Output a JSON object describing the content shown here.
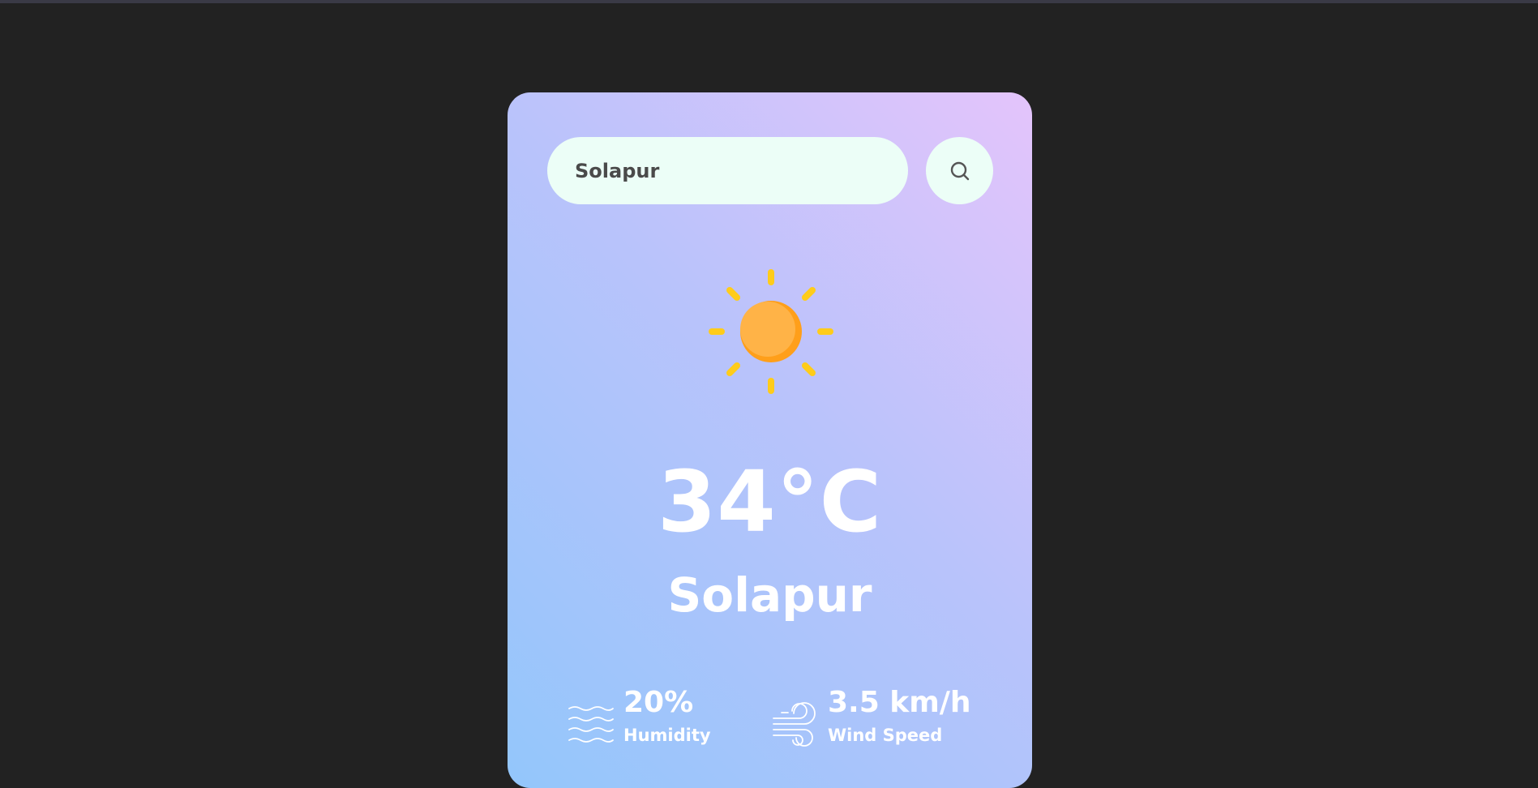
{
  "search": {
    "value": "Solapur",
    "icon": "search-icon"
  },
  "weather": {
    "icon": "sun-icon",
    "temperature": "34°C",
    "city": "Solapur"
  },
  "details": {
    "humidity": {
      "value": "20%",
      "label": "Humidity",
      "icon": "humidity-waves-icon"
    },
    "wind": {
      "value": "3.5 km/h",
      "label": "Wind Speed",
      "icon": "wind-icon"
    }
  },
  "colors": {
    "page_background": "#222222",
    "card_gradient": [
      "#e4c4fb",
      "#b9c3fb",
      "#93c6fb"
    ],
    "input_background": "#ecfef7",
    "sun_body": "#ffb347",
    "sun_shade": "#ff9f1a",
    "sun_rays": "#ffcc1a",
    "text": "#ffffff"
  }
}
